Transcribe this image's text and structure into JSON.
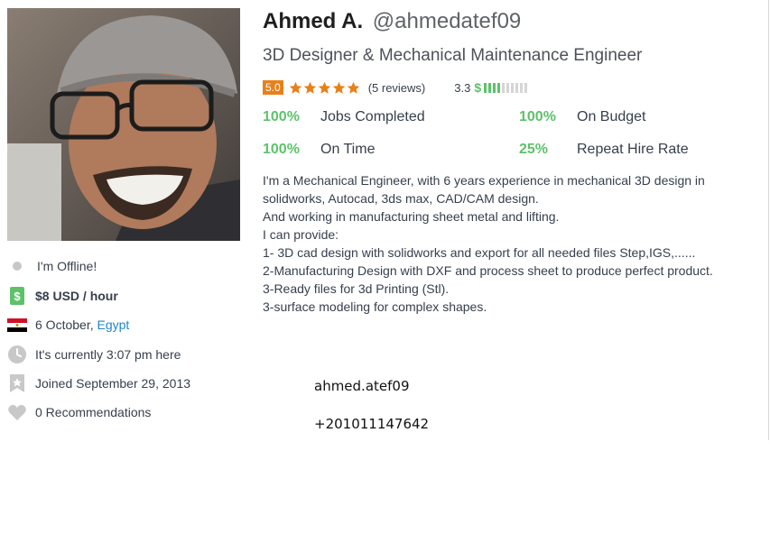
{
  "profile": {
    "name": "Ahmed A.",
    "username": "@ahmedatef09",
    "tagline": "3D Designer & Mechanical Maintenance Engineer",
    "rating": "5.0",
    "stars": 5,
    "reviews": "(5 reviews)",
    "earnings_score": "3.3",
    "earnings_bars_filled": 4,
    "earnings_bars_total": 10
  },
  "stats": [
    {
      "value": "100%",
      "label": "Jobs Completed"
    },
    {
      "value": "100%",
      "label": "On Budget"
    },
    {
      "value": "100%",
      "label": "On Time"
    },
    {
      "value": "25%",
      "label": "Repeat Hire Rate"
    }
  ],
  "about": [
    "I'm a Mechanical Engineer, with 6 years experience in mechanical 3D design in",
    "solidworks, Autocad, 3ds max, CAD/CAM design.",
    "And working in manufacturing sheet metal and lifting.",
    "I can provide:",
    "1- 3D cad design with solidworks and export for all needed files Step,IGS,......",
    "2-Manufacturing Design with DXF and process sheet to produce perfect product.",
    "3-Ready files for 3d Printing (Stl).",
    "3-surface modeling for complex shapes."
  ],
  "sidebar": {
    "status": "I'm Offline!",
    "rate": "$8 USD / hour",
    "city": "6 October,",
    "country": "Egypt",
    "local_time": "It's currently 3:07 pm here",
    "joined": "Joined September 29, 2013",
    "recommendations": "0 Recommendations"
  },
  "extra": {
    "handle": "ahmed.atef09",
    "phone": "+201011147642"
  },
  "colors": {
    "accent_green": "#5dc26a",
    "rating_orange": "#e8801a",
    "link_blue": "#1e87c8",
    "text": "#363F4D"
  },
  "icons": {
    "status": "status-dot-icon",
    "rate": "money-icon",
    "flag": "egypt-flag-icon",
    "time": "clock-icon",
    "joined": "badge-icon",
    "recommendations": "heart-icon"
  }
}
